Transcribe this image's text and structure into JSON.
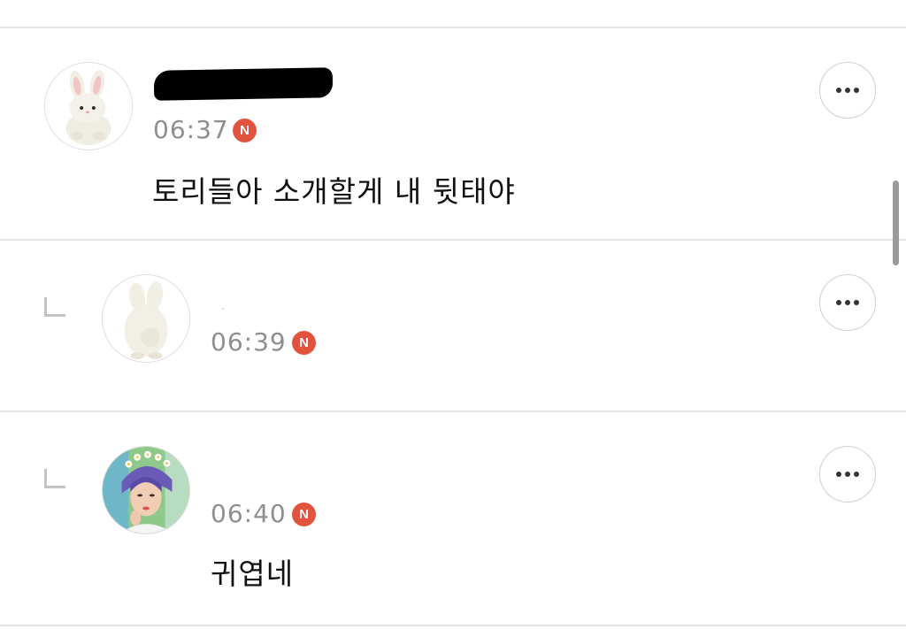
{
  "comments": [
    {
      "author_name": "",
      "time": "06:37",
      "new_badge": "N",
      "text": "토리들아 소개할게 내 뒷태야",
      "avatar_icon": "white-bunny-plush-front",
      "more_icon": "more-horizontal-icon",
      "is_reply": false
    },
    {
      "author_name": "·",
      "time": "06:39",
      "new_badge": "N",
      "text": "",
      "avatar_icon": "white-bunny-plush-back",
      "more_icon": "more-horizontal-icon",
      "is_reply": true
    },
    {
      "author_name": "",
      "time": "06:40",
      "new_badge": "N",
      "text": "귀엽네",
      "avatar_icon": "person-flower-crown-photo",
      "more_icon": "more-horizontal-icon",
      "is_reply": true
    }
  ],
  "colors": {
    "badge": "#e2533e",
    "time": "#8e8e8e",
    "divider": "#e4e4e4"
  }
}
